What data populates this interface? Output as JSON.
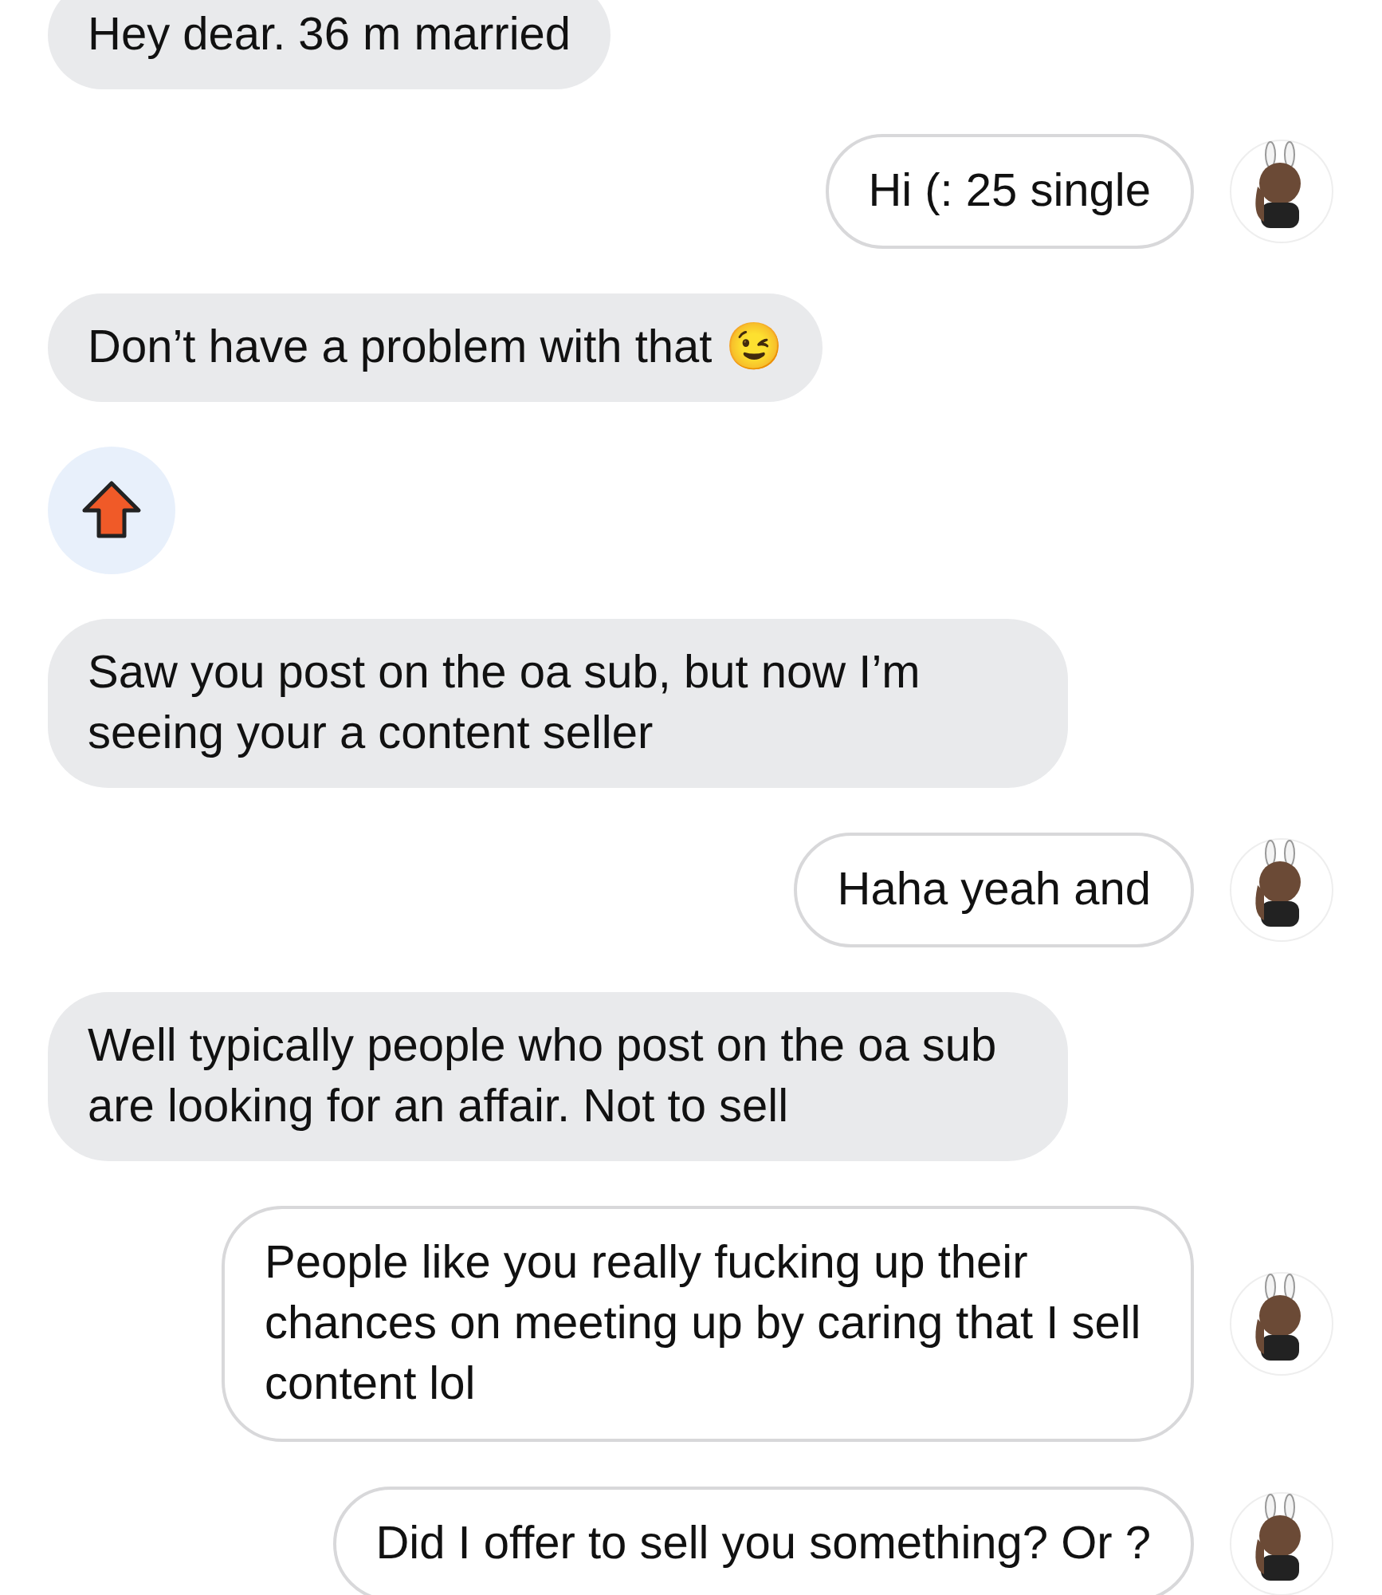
{
  "messages": [
    {
      "kind": "text",
      "outgoing": false,
      "text": "Hey dear. 36 m married"
    },
    {
      "kind": "text",
      "outgoing": true,
      "text": "Hi (: 25 single"
    },
    {
      "kind": "text",
      "outgoing": false,
      "text": "Don’t have a problem with that 😉"
    },
    {
      "kind": "sticker",
      "outgoing": false
    },
    {
      "kind": "text",
      "outgoing": false,
      "text": "Saw you post on the oa sub, but now I’m seeing your a content seller"
    },
    {
      "kind": "text",
      "outgoing": true,
      "text": "Haha yeah and"
    },
    {
      "kind": "text",
      "outgoing": false,
      "text": "Well typically people who post on the oa sub are looking for an affair. Not to sell"
    },
    {
      "kind": "text",
      "outgoing": true,
      "text": "People like you really fucking up their chances on meeting up by caring that I sell content lol"
    },
    {
      "kind": "text",
      "outgoing": true,
      "text": "Did I offer to sell you something? Or ?"
    }
  ]
}
